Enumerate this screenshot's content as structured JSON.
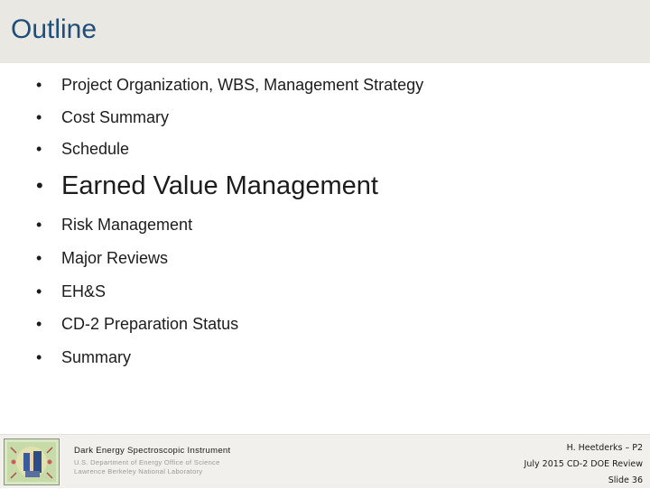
{
  "slide": {
    "title": "Outline",
    "bullets": [
      {
        "text": "Project Organization, WBS, Management Strategy",
        "emphasized": false
      },
      {
        "text": "Cost Summary",
        "emphasized": false
      },
      {
        "text": "Schedule",
        "emphasized": false
      },
      {
        "text": "Earned Value Management",
        "emphasized": true
      },
      {
        "text": "Risk Management",
        "emphasized": false
      },
      {
        "text": "Major Reviews",
        "emphasized": false
      },
      {
        "text": "EH&S",
        "emphasized": false
      },
      {
        "text": "CD-2 Preparation Status",
        "emphasized": false
      },
      {
        "text": "Summary",
        "emphasized": false
      }
    ],
    "bullet_glyph": "•"
  },
  "footer": {
    "project_name": "Dark Energy Spectroscopic Instrument",
    "agency": "U.S. Department of Energy Office of Science",
    "lab": "Lawrence Berkeley National Laboratory",
    "presenter": "H. Heetderks – P2",
    "event": "July 2015 CD-2 DOE Review",
    "slide_number": "Slide 36"
  },
  "colors": {
    "title": "#1f4e79",
    "title_bar": "#e9e8e3",
    "footer_bg": "#f1f0ec",
    "text": "#1c1c1c"
  }
}
